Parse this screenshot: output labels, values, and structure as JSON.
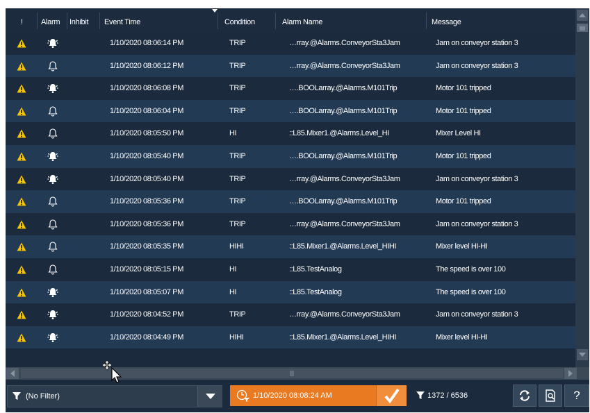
{
  "columns": {
    "severity": "!",
    "alarm": "Alarm",
    "inhibit": "Inhibit",
    "event_time": "Event Time",
    "condition": "Condition",
    "alarm_name": "Alarm Name",
    "message": "Message"
  },
  "rows": [
    {
      "bell": "ringing",
      "time": "1/10/2020 08:06:14 PM",
      "condition": "TRIP",
      "name": "…rray.@Alarms.ConveyorSta3Jam",
      "message": "Jam on conveyor station 3"
    },
    {
      "bell": "outline",
      "time": "1/10/2020 08:06:12 PM",
      "condition": "TRIP",
      "name": "…rray.@Alarms.ConveyorSta3Jam",
      "message": "Jam on conveyor station 3"
    },
    {
      "bell": "ringing",
      "time": "1/10/2020 08:06:08 PM",
      "condition": "TRIP",
      "name": "….BOOLarray.@Alarms.M101Trip",
      "message": "Motor 101 tripped"
    },
    {
      "bell": "outline",
      "time": "1/10/2020 08:06:04 PM",
      "condition": "TRIP",
      "name": "….BOOLarray.@Alarms.M101Trip",
      "message": "Motor 101 tripped"
    },
    {
      "bell": "outline",
      "time": "1/10/2020 08:05:50 PM",
      "condition": "HI",
      "name": "::L85.Mixer1.@Alarms.Level_HI",
      "message": "Mixer Level HI"
    },
    {
      "bell": "ringing",
      "time": "1/10/2020 08:05:40 PM",
      "condition": "TRIP",
      "name": "….BOOLarray.@Alarms.M101Trip",
      "message": "Motor 101 tripped"
    },
    {
      "bell": "ringing",
      "time": "1/10/2020 08:05:40 PM",
      "condition": "TRIP",
      "name": "…rray.@Alarms.ConveyorSta3Jam",
      "message": "Jam on conveyor station 3"
    },
    {
      "bell": "outline",
      "time": "1/10/2020 08:05:36 PM",
      "condition": "TRIP",
      "name": "….BOOLarray.@Alarms.M101Trip",
      "message": "Motor 101 tripped"
    },
    {
      "bell": "outline",
      "time": "1/10/2020 08:05:36 PM",
      "condition": "TRIP",
      "name": "…rray.@Alarms.ConveyorSta3Jam",
      "message": "Jam on conveyor station 3"
    },
    {
      "bell": "outline",
      "time": "1/10/2020 08:05:35 PM",
      "condition": "HIHI",
      "name": "::L85.Mixer1.@Alarms.Level_HIHI",
      "message": "Mixer level HI-HI"
    },
    {
      "bell": "outline",
      "time": "1/10/2020 08:05:15 PM",
      "condition": "HI",
      "name": "::L85.TestAnalog",
      "message": "The speed is over 100"
    },
    {
      "bell": "ringing",
      "time": "1/10/2020 08:05:07 PM",
      "condition": "HI",
      "name": "::L85.TestAnalog",
      "message": "The speed is over 100"
    },
    {
      "bell": "ringing",
      "time": "1/10/2020 08:04:52 PM",
      "condition": "TRIP",
      "name": "…rray.@Alarms.ConveyorSta3Jam",
      "message": "Jam on conveyor station 3"
    },
    {
      "bell": "ringing",
      "time": "1/10/2020 08:04:49 PM",
      "condition": "HIHI",
      "name": "::L85.Mixer1.@Alarms.Level_HIHI",
      "message": "Mixer level HI-HI"
    }
  ],
  "footer": {
    "filter_label": "(No Filter)",
    "ack_time": "1/10/2020 08:08:24 AM",
    "count": "1372 / 6536",
    "help": "?"
  },
  "colors": {
    "background": "#1b2a3c",
    "row_alt": "#233a55",
    "warning": "#f5c400",
    "accent_orange": "#ea7a21"
  },
  "icons": {
    "severity": "warning-triangle-icon",
    "alarm_active": "ringing-bell-icon",
    "alarm_inactive": "bell-outline-icon",
    "filter": "funnel-icon",
    "ack": "clock-funnel-icon",
    "acknowledge": "checkmark-icon",
    "refresh": "refresh-icon",
    "details": "document-search-icon"
  }
}
